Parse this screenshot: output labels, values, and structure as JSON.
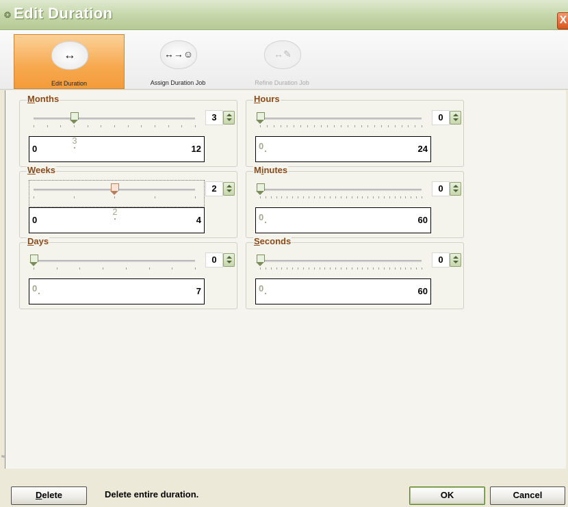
{
  "window": {
    "title": "Edit Duration",
    "close_label": "X"
  },
  "toolbar": {
    "tools": [
      {
        "label": "Edit Duration",
        "icon": "double-arrow-icon",
        "glyph": "↔",
        "state": "active"
      },
      {
        "label": "Assign Duration Job",
        "icon": "arrow-person-icon",
        "glyph": "↔→☺",
        "state": "normal"
      },
      {
        "label": "Refine Duration Job",
        "icon": "arrow-pencil-icon",
        "glyph": "↔✎",
        "state": "disabled"
      }
    ]
  },
  "groups": {
    "months": {
      "title": "Months",
      "accel": "M",
      "rest": "onths",
      "value": "3",
      "min": "0",
      "max": "12",
      "fraction": 0.25
    },
    "weeks": {
      "title": "Weeks",
      "accel": "W",
      "rest": "eeks",
      "value": "2",
      "min": "0",
      "max": "4",
      "fraction": 0.5
    },
    "days": {
      "title": "Days",
      "accel": "D",
      "rest": "ays",
      "value": "0",
      "min": "0",
      "max": "7",
      "fraction": 0
    },
    "hours": {
      "title": "Hours",
      "accel": "H",
      "rest": "ours",
      "value": "0",
      "min": "0",
      "max": "24",
      "fraction": 0
    },
    "minutes": {
      "title": "Minutes",
      "pre": "M",
      "accel": "i",
      "rest": "nutes",
      "value": "0",
      "min": "0",
      "max": "60",
      "fraction": 0
    },
    "seconds": {
      "title": "Seconds",
      "accel": "S",
      "rest": "econds",
      "value": "0",
      "min": "0",
      "max": "60",
      "fraction": 0
    }
  },
  "footer": {
    "delete_label": "Delete",
    "delete_accel": "D",
    "delete_rest": "elete",
    "hint": "Delete entire duration.",
    "ok_label": "OK",
    "cancel_label": "Cancel"
  },
  "colors": {
    "title_bar": "#c4d6a8",
    "active_tool": "#f7a94f",
    "group_title": "#8a4a1a",
    "close": "#d8541f"
  }
}
